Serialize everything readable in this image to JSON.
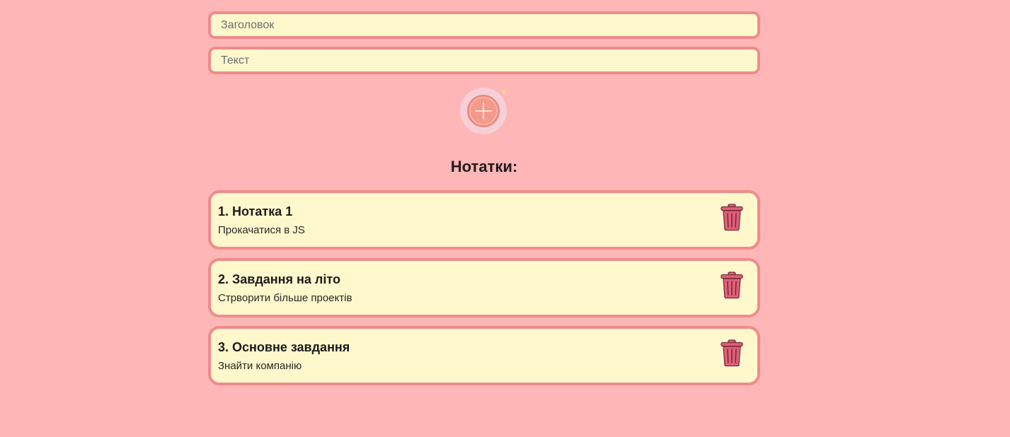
{
  "form": {
    "title_placeholder": "Заголовок",
    "title_value": "",
    "text_placeholder": "Текст",
    "text_value": "",
    "add_button_icon": "plus-circle-icon"
  },
  "notes_section": {
    "heading": "Нотатки:",
    "items": [
      {
        "title": "1. Нотатка 1",
        "text": "Прокачатися в JS",
        "delete_icon": "trash-icon"
      },
      {
        "title": "2. Завдання на літо",
        "text": "Стрворити більше проектів",
        "delete_icon": "trash-icon"
      },
      {
        "title": "3. Основне завдання",
        "text": "Знайти компанію",
        "delete_icon": "trash-icon"
      }
    ]
  },
  "colors": {
    "background": "#ffb6b6",
    "card_background": "#fef8cc",
    "border": "#ee8c8c",
    "trash": "#e0607a"
  }
}
